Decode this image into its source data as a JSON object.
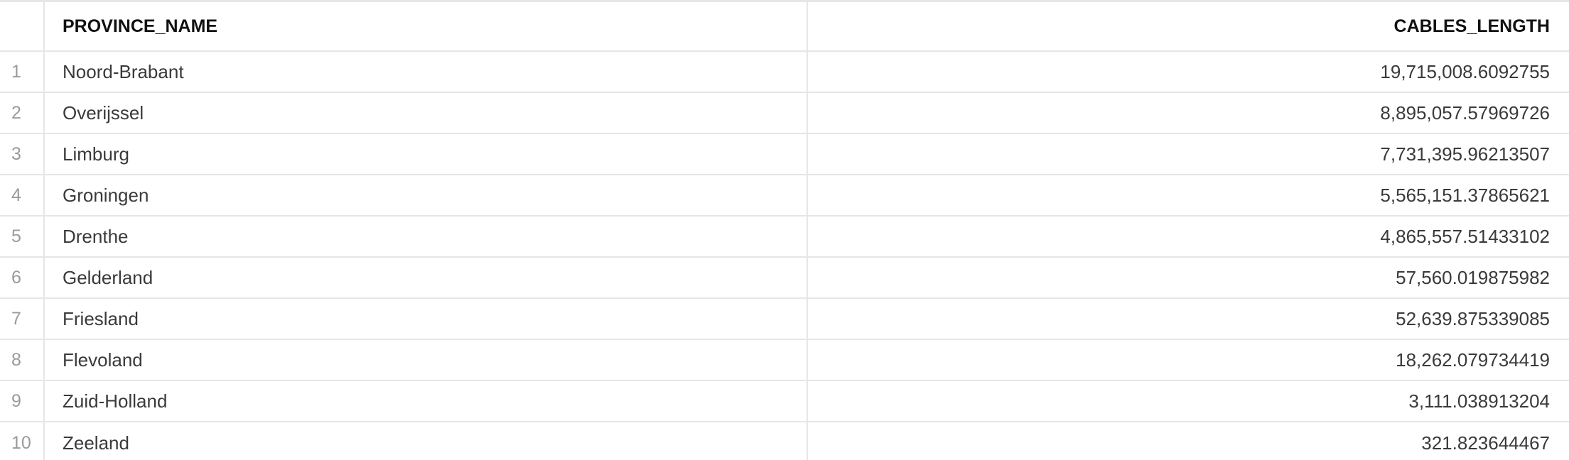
{
  "table": {
    "columns": [
      "PROVINCE_NAME",
      "CABLES_LENGTH"
    ],
    "rows": [
      {
        "index": "1",
        "province": "Noord-Brabant",
        "length": "19,715,008.6092755"
      },
      {
        "index": "2",
        "province": "Overijssel",
        "length": "8,895,057.57969726"
      },
      {
        "index": "3",
        "province": "Limburg",
        "length": "7,731,395.96213507"
      },
      {
        "index": "4",
        "province": "Groningen",
        "length": "5,565,151.37865621"
      },
      {
        "index": "5",
        "province": "Drenthe",
        "length": "4,865,557.51433102"
      },
      {
        "index": "6",
        "province": "Gelderland",
        "length": "57,560.019875982"
      },
      {
        "index": "7",
        "province": "Friesland",
        "length": "52,639.875339085"
      },
      {
        "index": "8",
        "province": "Flevoland",
        "length": "18,262.079734419"
      },
      {
        "index": "9",
        "province": "Zuid-Holland",
        "length": "3,111.038913204"
      },
      {
        "index": "10",
        "province": "Zeeland",
        "length": "321.823644467"
      }
    ]
  }
}
